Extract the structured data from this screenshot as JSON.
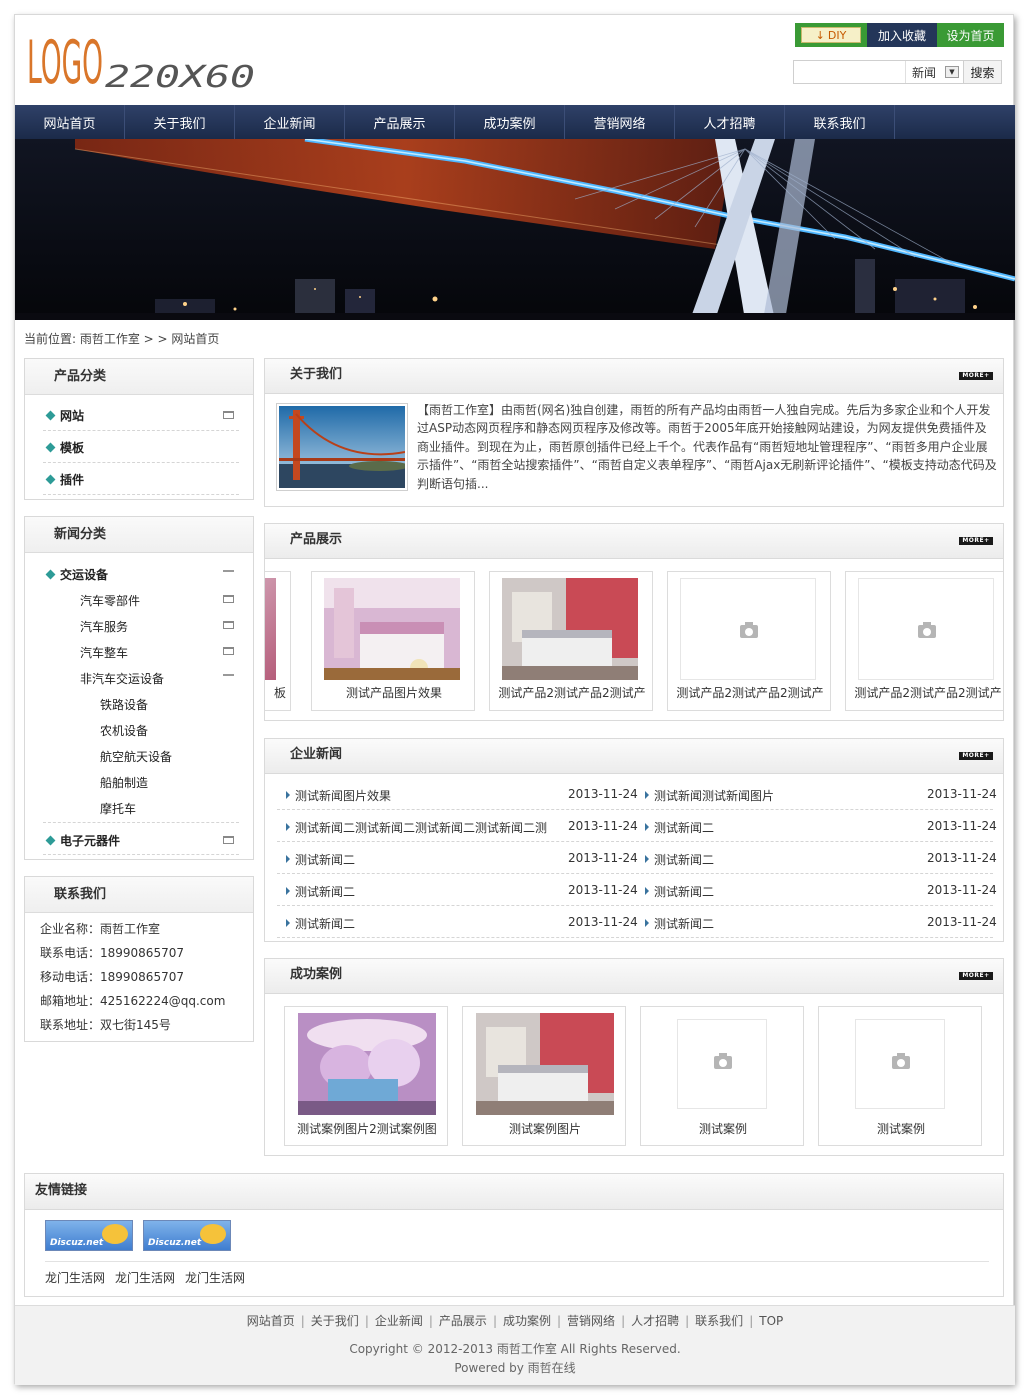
{
  "header": {
    "logo_text": "LOGO",
    "logo_size_text": "220X60",
    "diy_label": "DIY",
    "favorite_label": "加入收藏",
    "homepage_label": "设为首页",
    "search": {
      "value": "",
      "scope": "新闻",
      "button": "搜索"
    }
  },
  "nav": [
    "网站首页",
    "关于我们",
    "企业新闻",
    "产品展示",
    "成功案例",
    "营销网络",
    "人才招聘",
    "联系我们"
  ],
  "breadcrumb": "当前位置: 雨哲工作室 > > 网站首页",
  "product_categories": {
    "title": "产品分类",
    "items": [
      "网站",
      "模板",
      "插件"
    ]
  },
  "news_categories": {
    "title": "新闻分类",
    "items": [
      "交运设备",
      "汽车零部件",
      "汽车服务",
      "汽车整车",
      "非汽车交运设备",
      "铁路设备",
      "农机设备",
      "航空航天设备",
      "船舶制造",
      "摩托车",
      "电子元器件"
    ]
  },
  "contact": {
    "title": "联系我们",
    "lines": [
      "企业名称：雨哲工作室",
      "联系电话：18990865707",
      "移动电话：18990865707",
      "邮箱地址：425162224@qq.com",
      "联系地址：双七街145号"
    ]
  },
  "about": {
    "title": "关于我们",
    "more": "MORE+",
    "text": "【雨哲工作室】由雨哲(网名)独自创建，雨哲的所有产品均由雨哲一人独自完成。先后为多家企业和个人开发过ASP动态网页程序和静态网页程序及修改等。雨哲于2005年底开始接触网站建设，为网友提供免费插件及商业插件。到现在为止，雨哲原创插件已经上千个。代表作品有“雨哲短地址管理程序”、“雨哲多用户企业展示插件”、“雨哲全站搜索插件”、“雨哲自定义表单程序”、“雨哲Ajax无刷新评论插件”、“模板支持动态代码及判断语句插..."
  },
  "products": {
    "title": "产品展示",
    "more": "MORE+",
    "items": [
      "板",
      "测试产品图片效果",
      "测试产品2测试产品2测试产",
      "测试产品2测试产品2测试产",
      "测试产品2测试产品2测试产"
    ]
  },
  "news": {
    "title": "企业新闻",
    "more": "MORE+",
    "left": [
      {
        "title": "测试新闻图片效果",
        "date": "2013-11-24"
      },
      {
        "title": "测试新闻二测试新闻二测试新闻二测试新闻二测",
        "date": "2013-11-24"
      },
      {
        "title": "测试新闻二",
        "date": "2013-11-24"
      },
      {
        "title": "测试新闻二",
        "date": "2013-11-24"
      },
      {
        "title": "测试新闻二",
        "date": "2013-11-24"
      }
    ],
    "right": [
      {
        "title": "测试新闻测试新闻图片",
        "date": "2013-11-24"
      },
      {
        "title": "测试新闻二",
        "date": "2013-11-24"
      },
      {
        "title": "测试新闻二",
        "date": "2013-11-24"
      },
      {
        "title": "测试新闻二",
        "date": "2013-11-24"
      },
      {
        "title": "测试新闻二",
        "date": "2013-11-24"
      }
    ]
  },
  "cases": {
    "title": "成功案例",
    "more": "MORE+",
    "items": [
      "测试案例图片2测试案例图",
      "测试案例图片",
      "测试案例",
      "测试案例"
    ]
  },
  "links": {
    "title": "友情链接",
    "logos": [
      "Discuz.net",
      "Discuz.net"
    ],
    "text_links": [
      "龙门生活网",
      "龙门生活网",
      "龙门生活网"
    ]
  },
  "footer": {
    "nav": [
      "网站首页",
      "关于我们",
      "企业新闻",
      "产品展示",
      "成功案例",
      "营销网络",
      "人才招聘",
      "联系我们",
      "TOP"
    ],
    "separator": "|",
    "copyright": "Copyright © 2012-2013 雨哲工作室 All Rights Reserved.",
    "powered": "Powered by 雨哲在线"
  },
  "colors": {
    "nav_bg": "#1b2a49",
    "green": "#3a9a35",
    "accent_teal": "#2d9b97",
    "logo_orange": "#d9762a"
  }
}
